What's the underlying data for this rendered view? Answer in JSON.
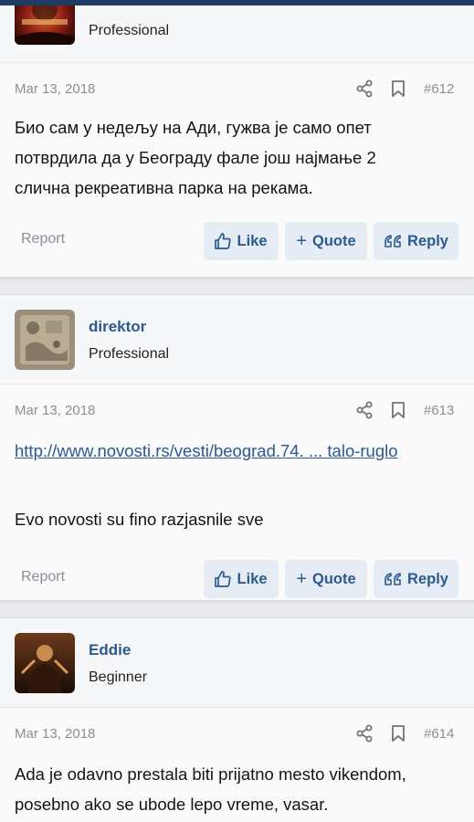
{
  "posts": [
    {
      "username": "",
      "user_title": "Professional",
      "date": "Mar 13, 2018",
      "number": "#612",
      "lines": [
        "Био сам у недељу на Ади, гужва је само опет",
        "потврдила да у Београду фале још најмање 2",
        "слична рекреативна парка на рекама."
      ],
      "avatar_icon": "user-avatar-dark-red"
    },
    {
      "username": "direktor",
      "user_title": "Professional",
      "date": "Mar 13, 2018",
      "number": "#613",
      "link": "http://www.novosti.rs/vesti/beograd.74. ... talo-ruglo",
      "text": "Evo novosti su fino razjasnile sve",
      "avatar_icon": "user-avatar-stone-relief"
    },
    {
      "username": "Eddie",
      "user_title": "Beginner",
      "date": "Mar 13, 2018",
      "number": "#614",
      "lines": [
        "Ada je odavno prestala biti prijatno mesto vikendom,",
        "posebno ako se ubode lepo vreme, vasar."
      ],
      "avatar_icon": "user-avatar-rain-figure"
    }
  ],
  "actions": {
    "report": "Report",
    "like": "Like",
    "quote": "Quote",
    "reply": "Reply"
  },
  "colors": {
    "accent": "#2d5a8e",
    "button_bg": "#e5ecf4",
    "meta_text": "#8a8f96",
    "top_bar": "#1f3b63"
  }
}
